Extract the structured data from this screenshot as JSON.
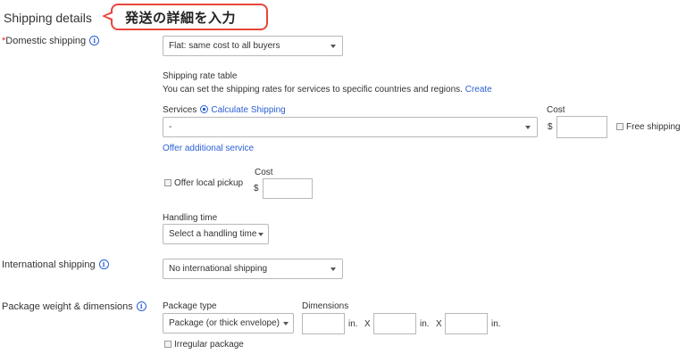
{
  "section_title": "Shipping details",
  "callout_text": "発送の詳細を入力",
  "domestic": {
    "required_mark": "*",
    "label": "Domestic shipping",
    "select_value": "Flat: same cost to all buyers"
  },
  "rate_table": {
    "title": "Shipping rate table",
    "description": "You can set the shipping rates for services to specific countries and regions.",
    "create_link": "Create"
  },
  "services": {
    "label": "Services",
    "calculate_link": "Calculate Shipping",
    "select_value": "-",
    "cost_label": "Cost",
    "currency": "$",
    "free_shipping_label": "Free shipping",
    "offer_additional_link": "Offer additional service"
  },
  "local_pickup": {
    "label": "Offer local pickup",
    "cost_label": "Cost",
    "currency": "$"
  },
  "handling_time": {
    "label": "Handling time",
    "select_value": "Select a handling time"
  },
  "international": {
    "label": "International shipping",
    "select_value": "No international shipping"
  },
  "package": {
    "label": "Package weight & dimensions",
    "type_label": "Package type",
    "type_value": "Package (or thick envelope)",
    "dimensions_label": "Dimensions",
    "unit": "in.",
    "times": "X",
    "irregular_label": "Irregular package"
  },
  "icons": {
    "info": "info-circle-icon",
    "calculator": "calculator-icon",
    "dropdown": "chevron-down-icon"
  },
  "colors": {
    "link": "#2a5fd6",
    "callout_border": "#e8453c",
    "required": "#d93025"
  }
}
